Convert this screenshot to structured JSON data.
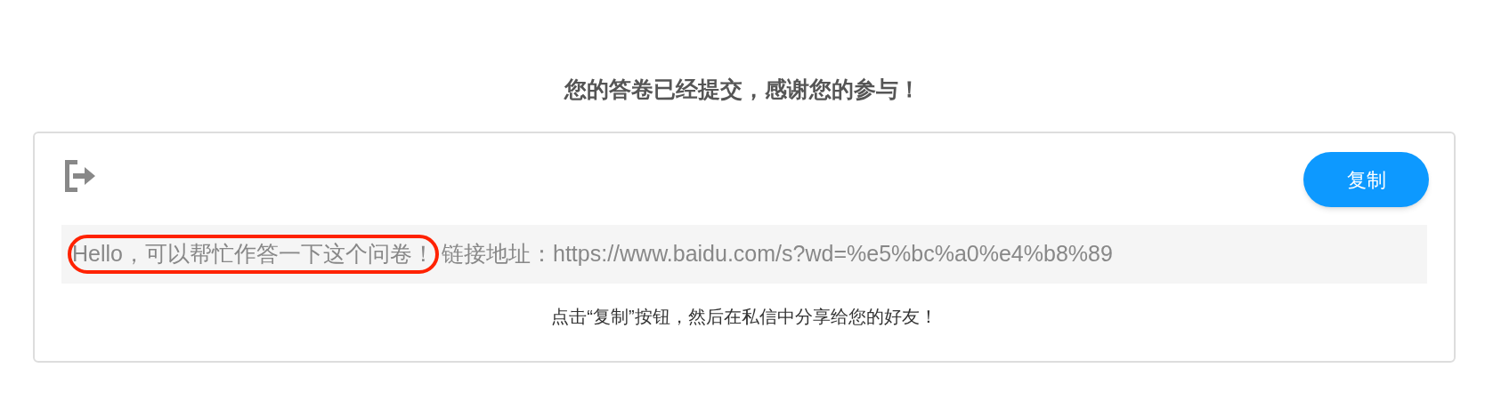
{
  "title": "您的答卷已经提交，感谢您的参与！",
  "share_card": {
    "copy_button": "复制",
    "message": {
      "greeting": "Hello，可以帮忙作答一下这个问卷！",
      "greeting_circled": true,
      "link": "链接地址：https://www.baidu.com/s?wd=%e5%bc%a0%e4%b8%89"
    },
    "hint": "点击“复制”按钮，然后在私信中分享给您的好友！"
  }
}
